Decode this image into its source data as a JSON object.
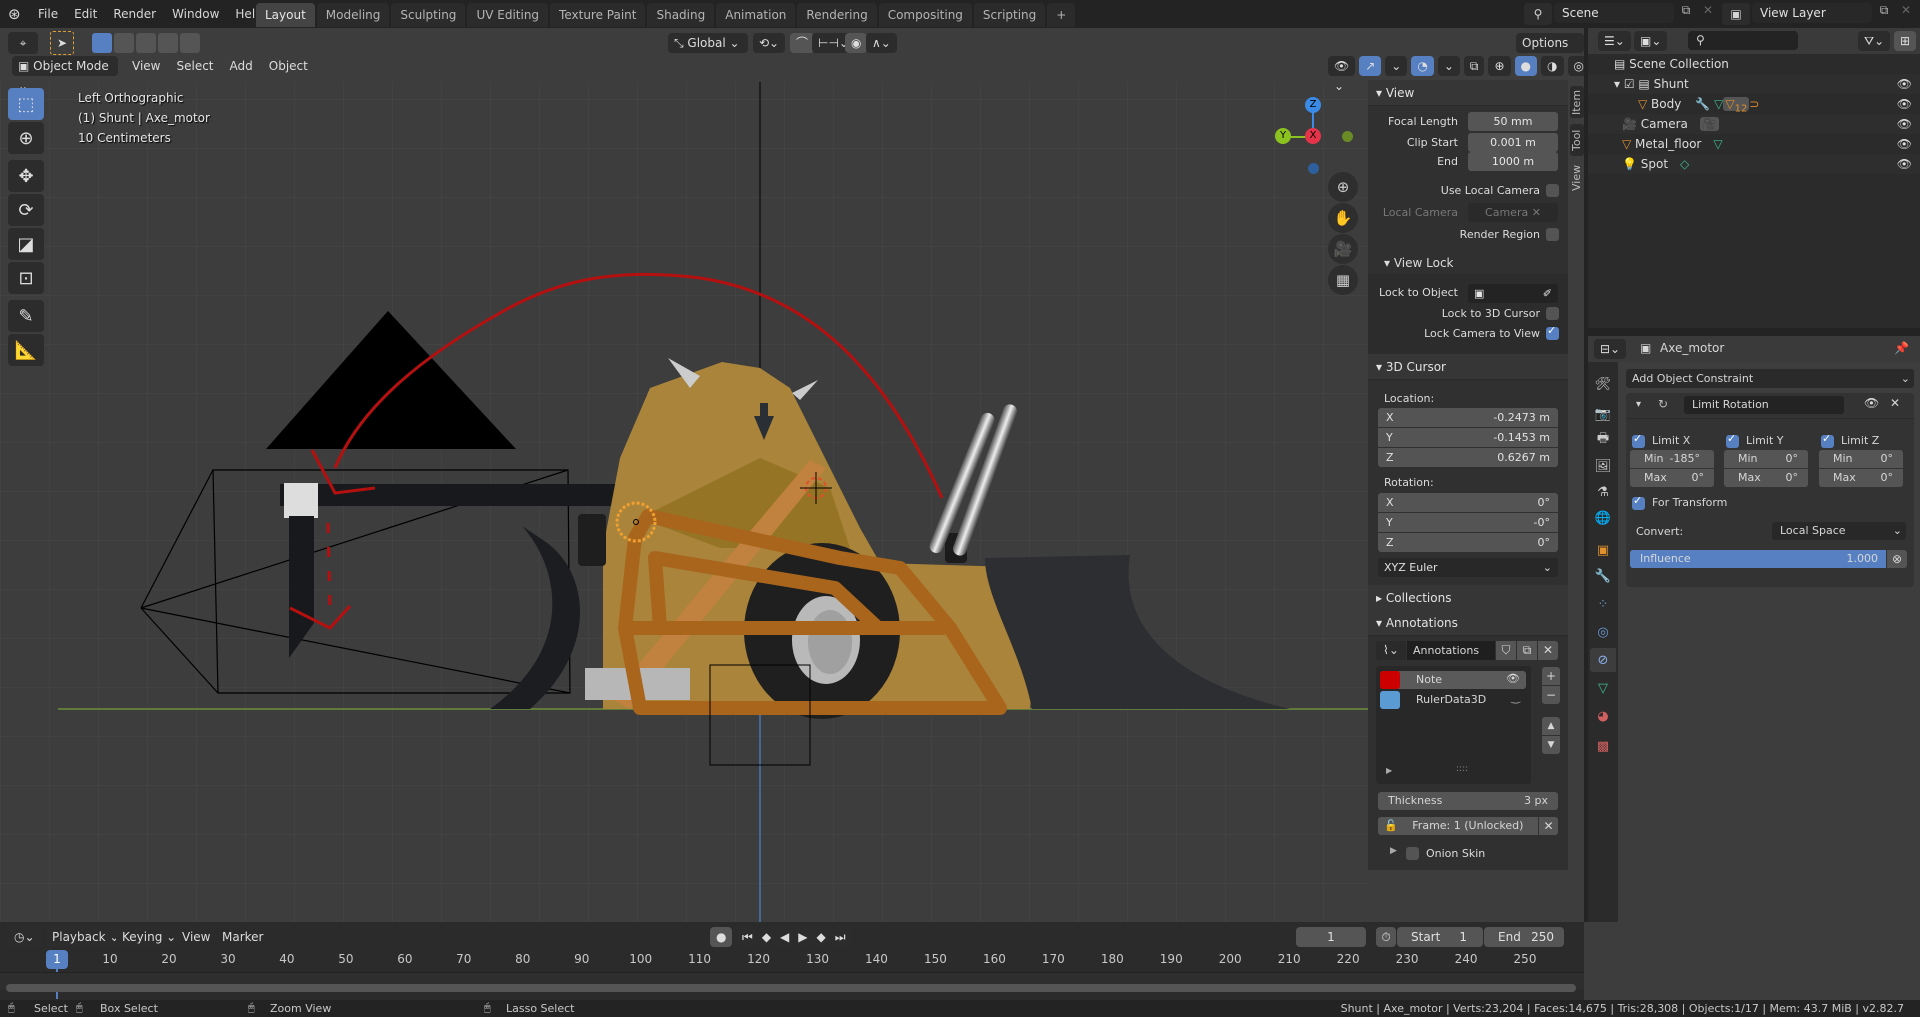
{
  "topbar": {
    "menus": [
      "File",
      "Edit",
      "Render",
      "Window",
      "Help"
    ],
    "workspaces": [
      "Layout",
      "Modeling",
      "Sculpting",
      "UV Editing",
      "Texture Paint",
      "Shading",
      "Animation",
      "Rendering",
      "Compositing",
      "Scripting"
    ],
    "active_workspace": "Layout",
    "add_tab": "+",
    "scene": "Scene",
    "view_layer": "View Layer"
  },
  "viewport": {
    "mode": "Object Mode",
    "menus": [
      "View",
      "Select",
      "Add",
      "Object"
    ],
    "orientation": "Global",
    "options": "Options",
    "overlay_lines": [
      "Left Orthographic",
      "(1) Shunt | Axe_motor",
      "10 Centimeters"
    ],
    "gizmo": {
      "x": "X",
      "y": "Y",
      "z": "Z"
    }
  },
  "npanel": {
    "tabs": [
      "Item",
      "Tool",
      "View"
    ],
    "view": {
      "title": "View",
      "focal_length_label": "Focal Length",
      "focal_length": "50 mm",
      "clip_start_label": "Clip Start",
      "clip_start": "0.001 m",
      "clip_end_label": "End",
      "clip_end": "1000 m",
      "use_local_camera": "Use Local Camera",
      "local_camera_label": "Local Camera",
      "local_camera": "Camera",
      "render_region": "Render Region",
      "view_lock_title": "View Lock",
      "lock_to_object": "Lock to Object",
      "lock_to_cursor": "Lock to 3D Cursor",
      "lock_camera": "Lock Camera to View",
      "lock_camera_checked": true
    },
    "cursor": {
      "title": "3D Cursor",
      "location_label": "Location:",
      "location": [
        {
          "axis": "X",
          "value": "-0.2473 m"
        },
        {
          "axis": "Y",
          "value": "-0.1453 m"
        },
        {
          "axis": "Z",
          "value": "0.6267 m"
        }
      ],
      "rotation_label": "Rotation:",
      "rotation": [
        {
          "axis": "X",
          "value": "0°"
        },
        {
          "axis": "Y",
          "value": "-0°"
        },
        {
          "axis": "Z",
          "value": "0°"
        }
      ],
      "mode": "XYZ Euler"
    },
    "collections_title": "Collections",
    "annotations": {
      "title": "Annotations",
      "datablock": "Annotations",
      "layers": [
        {
          "name": "Note",
          "color": "#cc0000",
          "active": true
        },
        {
          "name": "RulerData3D",
          "color": "#5a9bd4",
          "active": false
        }
      ],
      "thickness_label": "Thickness",
      "thickness": "3 px",
      "frame": "Frame: 1 (Unlocked)",
      "onion_skin": "Onion Skin"
    }
  },
  "outliner": {
    "root": "Scene Collection",
    "items": [
      {
        "name": "Shunt",
        "level": 1,
        "type": "collection"
      },
      {
        "name": "Body",
        "level": 2,
        "type": "mesh",
        "badge": "12"
      },
      {
        "name": "Camera",
        "level": 1,
        "type": "camera"
      },
      {
        "name": "Metal_floor",
        "level": 1,
        "type": "mesh"
      },
      {
        "name": "Spot",
        "level": 1,
        "type": "light"
      }
    ]
  },
  "properties": {
    "object": "Axe_motor",
    "add_constraint": "Add Object Constraint",
    "constraint": {
      "name": "Limit Rotation",
      "limits": [
        {
          "label": "Limit X",
          "checked": true,
          "min_label": "Min",
          "min": "-185°",
          "max_label": "Max",
          "max": "0°"
        },
        {
          "label": "Limit Y",
          "checked": true,
          "min_label": "Min",
          "min": "0°",
          "max_label": "Max",
          "max": "0°"
        },
        {
          "label": "Limit Z",
          "checked": true,
          "min_label": "Min",
          "min": "0°",
          "max_label": "Max",
          "max": "0°"
        }
      ],
      "for_transform": "For Transform",
      "convert_label": "Convert:",
      "convert": "Local Space",
      "influence_label": "Influence",
      "influence": "1.000",
      "influence_fraction": 1.0
    }
  },
  "timeline": {
    "menus": [
      "Playback",
      "Keying",
      "View",
      "Marker"
    ],
    "current_frame": "1",
    "start_label": "Start",
    "start": "1",
    "end_label": "End",
    "end": "250",
    "ticks": [
      "10",
      "20",
      "30",
      "40",
      "50",
      "60",
      "70",
      "80",
      "90",
      "100",
      "110",
      "120",
      "130",
      "140",
      "150",
      "160",
      "170",
      "180",
      "190",
      "200",
      "210",
      "220",
      "230",
      "240",
      "250"
    ]
  },
  "statusbar": {
    "hints": [
      "Select",
      "Box Select",
      "Zoom View",
      "Lasso Select"
    ],
    "info": "Shunt | Axe_motor | Verts:23,204 | Faces:14,675 | Tris:28,308 | Objects:1/17 | Mem: 43.7 MiB | v2.82.7"
  }
}
